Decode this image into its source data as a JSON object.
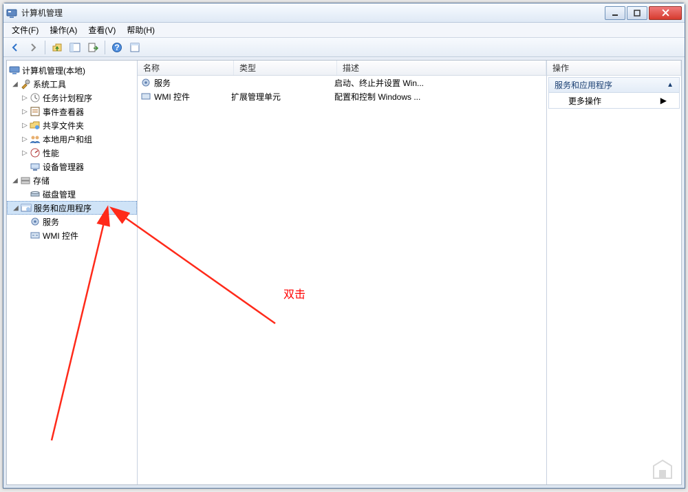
{
  "window": {
    "title": "计算机管理"
  },
  "menubar": {
    "file": "文件(F)",
    "action": "操作(A)",
    "view": "查看(V)",
    "help": "帮助(H)"
  },
  "tree": {
    "root": "计算机管理(本地)",
    "system_tools": {
      "label": "系统工具",
      "items": [
        "任务计划程序",
        "事件查看器",
        "共享文件夹",
        "本地用户和组",
        "性能",
        "设备管理器"
      ]
    },
    "storage": {
      "label": "存储",
      "items": [
        "磁盘管理"
      ]
    },
    "services_apps": {
      "label": "服务和应用程序",
      "items": [
        "服务",
        "WMI 控件"
      ]
    }
  },
  "list": {
    "headers": {
      "name": "名称",
      "type": "类型",
      "desc": "描述"
    },
    "rows": [
      {
        "name": "服务",
        "type": "",
        "desc": "启动、终止并设置 Win..."
      },
      {
        "name": "WMI 控件",
        "type": "扩展管理单元",
        "desc": "配置和控制 Windows ..."
      }
    ]
  },
  "actions": {
    "header": "操作",
    "section": "服务和应用程序",
    "more": "更多操作"
  },
  "annotation": {
    "label": "双击"
  }
}
